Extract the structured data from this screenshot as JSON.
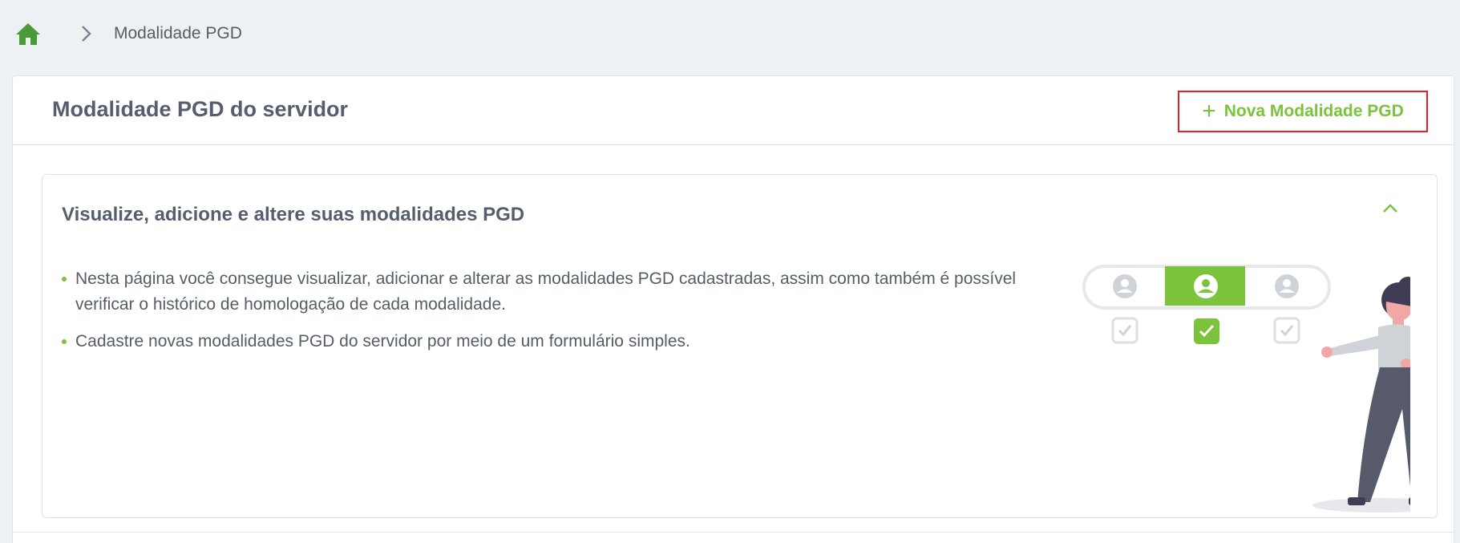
{
  "breadcrumb": {
    "home_icon": "home-icon",
    "separator_icon": "chevron-right-icon",
    "current": "Modalidade PGD"
  },
  "card": {
    "title": "Modalidade PGD do servidor",
    "new_button_label": "Nova Modalidade PGD",
    "new_button_icon": "plus-icon"
  },
  "panel": {
    "title": "Visualize, adicione e altere suas modalidades PGD",
    "collapse_icon": "chevron-up-icon",
    "bullets": [
      "Nesta página você consegue visualizar, adicionar e alterar as modalidades PGD cadastradas, assim como também é possível verificar o histórico de homologação de cada modalidade.",
      "Cadastre novas modalidades PGD do servidor por meio de um formulário simples."
    ]
  },
  "colors": {
    "accent": "#7cc33c",
    "home_icon": "#4a9a3a",
    "button_highlight_border": "#e5202e",
    "text": "#555d66",
    "background": "#eef1f4"
  }
}
